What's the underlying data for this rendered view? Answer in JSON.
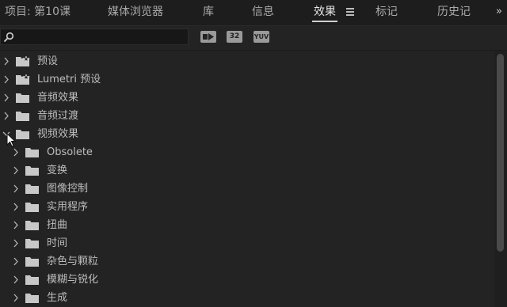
{
  "tabs": [
    {
      "label": "项目: 第10课"
    },
    {
      "label": "媒体浏览器"
    },
    {
      "label": "库"
    },
    {
      "label": "信息"
    },
    {
      "label": "效果"
    },
    {
      "label": "标记"
    },
    {
      "label": "历史记"
    }
  ],
  "active_tab": "效果",
  "overflow_label": "»",
  "search": {
    "value": "",
    "placeholder": ""
  },
  "filters": [
    {
      "label": "",
      "icon": "accelerated-effects-icon"
    },
    {
      "label": "32",
      "icon": "32-bit-color-icon"
    },
    {
      "label": "YUV",
      "icon": "yuv-effects-icon"
    }
  ],
  "tree": [
    {
      "label": "预设",
      "level": 0,
      "expanded": false,
      "icon": "preset-bin-icon"
    },
    {
      "label": "Lumetri 预设",
      "level": 0,
      "expanded": false,
      "icon": "preset-bin-icon"
    },
    {
      "label": "音频效果",
      "level": 0,
      "expanded": false,
      "icon": "folder-icon"
    },
    {
      "label": "音频过渡",
      "level": 0,
      "expanded": false,
      "icon": "folder-icon"
    },
    {
      "label": "视频效果",
      "level": 0,
      "expanded": true,
      "icon": "folder-icon"
    },
    {
      "label": "Obsolete",
      "level": 1,
      "expanded": false,
      "icon": "folder-icon"
    },
    {
      "label": "变换",
      "level": 1,
      "expanded": false,
      "icon": "folder-icon"
    },
    {
      "label": "图像控制",
      "level": 1,
      "expanded": false,
      "icon": "folder-icon"
    },
    {
      "label": "实用程序",
      "level": 1,
      "expanded": false,
      "icon": "folder-icon"
    },
    {
      "label": "扭曲",
      "level": 1,
      "expanded": false,
      "icon": "folder-icon"
    },
    {
      "label": "时间",
      "level": 1,
      "expanded": false,
      "icon": "folder-icon"
    },
    {
      "label": "杂色与颗粒",
      "level": 1,
      "expanded": false,
      "icon": "folder-icon"
    },
    {
      "label": "模糊与锐化",
      "level": 1,
      "expanded": false,
      "icon": "folder-icon"
    },
    {
      "label": "生成",
      "level": 1,
      "expanded": false,
      "icon": "folder-icon"
    }
  ],
  "colors": {
    "background": "#232323",
    "text": "#bdbdbd",
    "active_tab": "#e6e6e6",
    "folder": "#c8c8c8"
  }
}
